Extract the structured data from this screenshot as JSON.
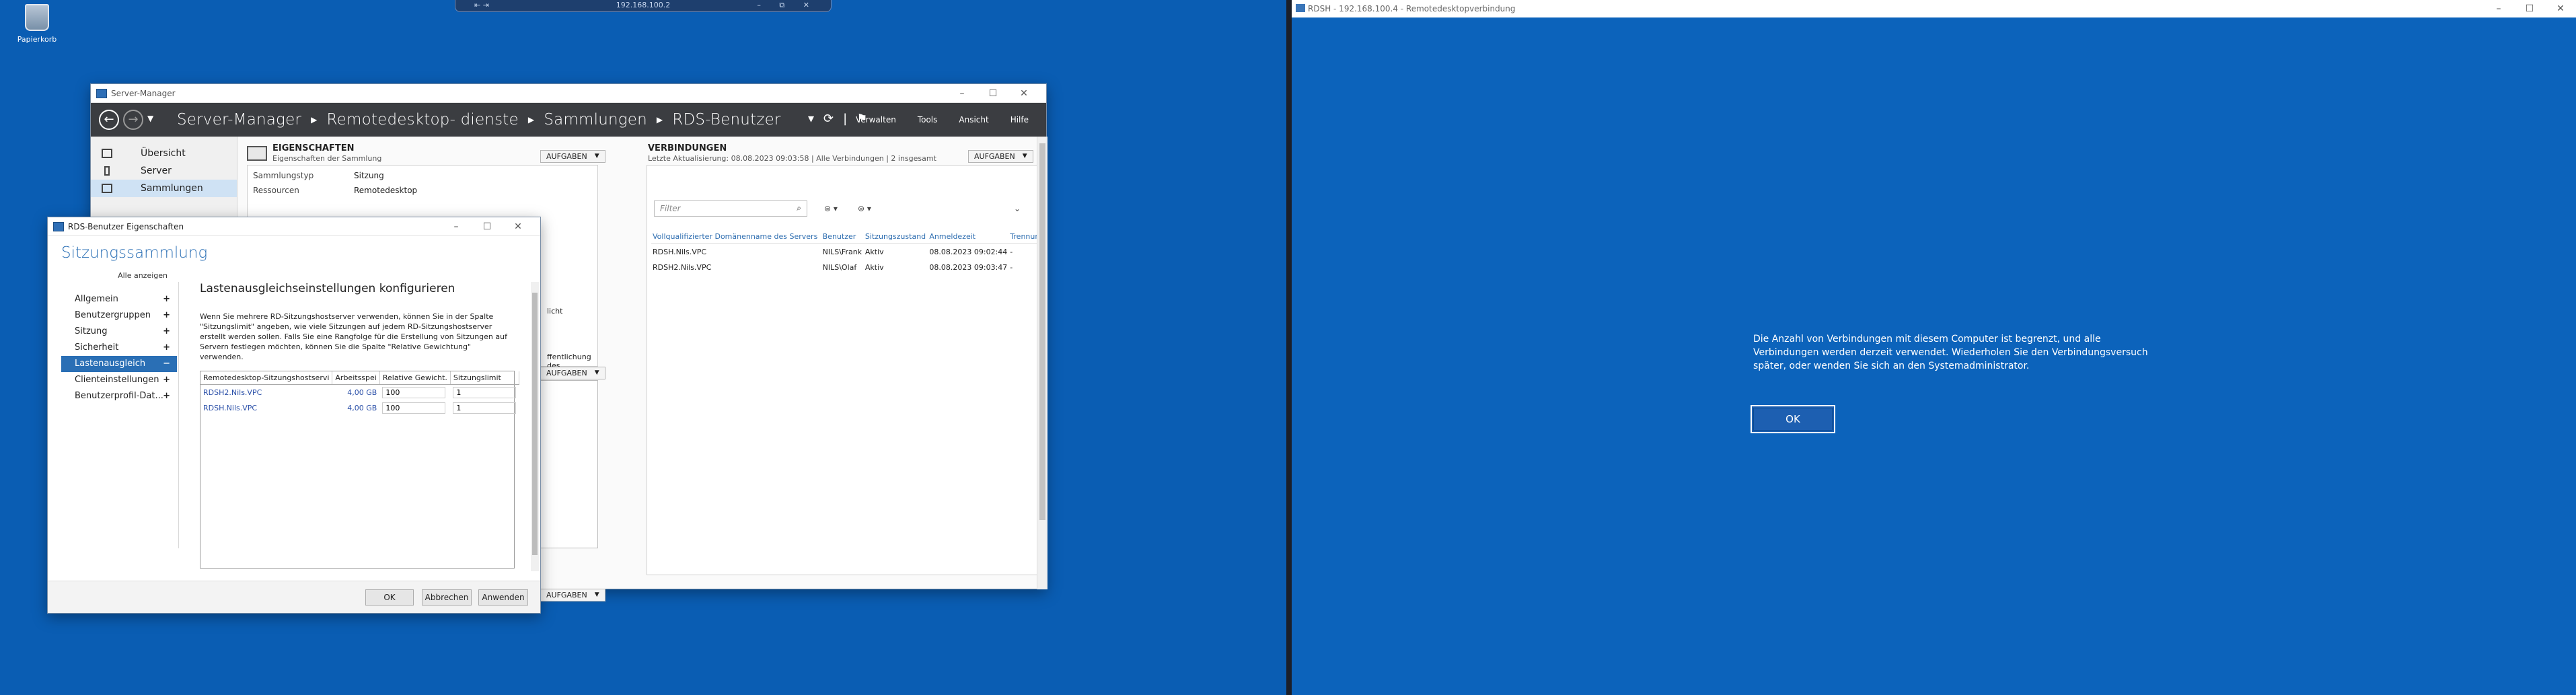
{
  "rdp_bar": {
    "address": "192.168.100.2",
    "left_controls": "⇤ ⇥",
    "right_controls": "– ⧉ ✕"
  },
  "desktop": {
    "recycle_bin": "Papierkorb"
  },
  "server_manager": {
    "title": "Server-Manager",
    "breadcrumb": [
      "Server-Manager",
      "Remotedesktop- dienste",
      "Sammlungen",
      "RDS-Benutzer"
    ],
    "menu": [
      "Verwalten",
      "Tools",
      "Ansicht",
      "Hilfe"
    ],
    "sidebar": [
      {
        "label": "Übersicht"
      },
      {
        "label": "Server"
      },
      {
        "label": "Sammlungen"
      }
    ],
    "properties": {
      "header": "EIGENSCHAFTEN",
      "subheader": "Eigenschaften der Sammlung",
      "tasks": "AUFGABEN",
      "rows": [
        {
          "key": "Sammlungstyp",
          "value": "Sitzung"
        },
        {
          "key": "Ressourcen",
          "value": "Remotedesktop"
        }
      ],
      "partial_text_1": "licht",
      "partial_text_2": "ffentlichung des"
    },
    "tasks_label": "AUFGABEN",
    "connections": {
      "header": "VERBINDUNGEN",
      "subheader": "Letzte Aktualisierung: 08.08.2023 09:03:58 | Alle Verbindungen | 2 insgesamt",
      "tasks": "AUFGABEN",
      "filter_placeholder": "Filter",
      "columns": [
        "Vollqualifizierter Domänenname des Servers",
        "Benutzer",
        "Sitzungszustand",
        "Anmeldezeit",
        "Trennun"
      ],
      "rows": [
        {
          "server": "RDSH.Nils.VPC",
          "user": "NILS\\Frank",
          "state": "Aktiv",
          "logon": "08.08.2023 09:02:44",
          "disc": "-"
        },
        {
          "server": "RDSH2.Nils.VPC",
          "user": "NILS\\Olaf",
          "state": "Aktiv",
          "logon": "08.08.2023 09:03:47",
          "disc": "-"
        }
      ]
    }
  },
  "dialog": {
    "title": "RDS-Benutzer Eigenschaften",
    "heading": "Sitzungssammlung",
    "show_all": "Alle anzeigen",
    "nav": [
      {
        "label": "Allgemein",
        "pm": "+"
      },
      {
        "label": "Benutzergruppen",
        "pm": "+"
      },
      {
        "label": "Sitzung",
        "pm": "+"
      },
      {
        "label": "Sicherheit",
        "pm": "+"
      },
      {
        "label": "Lastenausgleich",
        "pm": "−"
      },
      {
        "label": "Clienteinstellungen",
        "pm": "+"
      },
      {
        "label": "Benutzerprofil-Dat...",
        "pm": "+"
      }
    ],
    "section_title": "Lastenausgleichseinstellungen konfigurieren",
    "description": "Wenn Sie mehrere RD-Sitzungshostserver verwenden, können Sie in der Spalte \"Sitzungslimit\" angeben, wie viele Sitzungen auf jedem RD-Sitzungshostserver erstellt werden sollen. Falls Sie eine Rangfolge für die Erstellung von Sitzungen auf Servern festlegen möchten, können Sie die Spalte \"Relative Gewichtung\" verwenden.",
    "grid": {
      "columns": [
        "Remotedesktop-Sitzungshostservi",
        "Arbeitsspei",
        "Relative Gewicht.",
        "Sitzungslimit"
      ],
      "rows": [
        {
          "server": "RDSH2.Nils.VPC",
          "memory": "4,00 GB",
          "weight": "100",
          "limit": "1"
        },
        {
          "server": "RDSH.Nils.VPC",
          "memory": "4,00 GB",
          "weight": "100",
          "limit": "1"
        }
      ]
    },
    "buttons": {
      "ok": "OK",
      "cancel": "Abbrechen",
      "apply": "Anwenden"
    }
  },
  "rdp_window": {
    "title": "RDSH - 192.168.100.4 - Remotedesktopverbindung",
    "message": "Die Anzahl von Verbindungen mit diesem Computer ist begrenzt, und alle Verbindungen werden derzeit verwendet. Wiederholen Sie den Verbindungsversuch später, oder wenden Sie sich an den Systemadministrator.",
    "ok": "OK"
  }
}
